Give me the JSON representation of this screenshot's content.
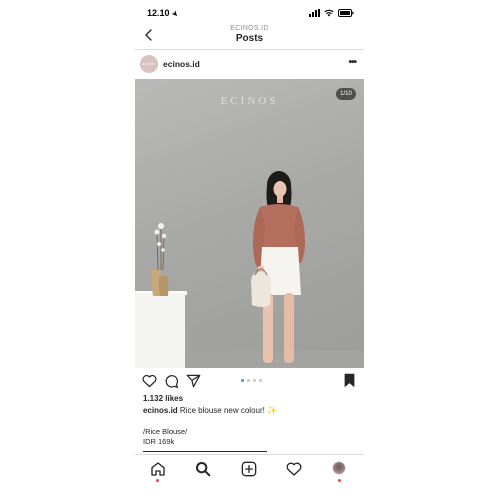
{
  "status_bar": {
    "time": "12.10"
  },
  "header": {
    "account": "ECINOS.ID",
    "title": "Posts"
  },
  "post": {
    "avatar_text": "ECINOS",
    "username": "ecinos.id",
    "image": {
      "brand": "ECINOS",
      "counter": "1/10"
    },
    "carousel": {
      "dot_count": 4,
      "active_index": 0
    },
    "likes": "1.132 likes",
    "caption": {
      "username": "ecinos.id",
      "text": "Rice blouse new colour! ✨",
      "line1": "/Rice Blouse/",
      "line2": "IDR 169k"
    }
  },
  "colors": {
    "accent_blue": "#3897f0",
    "notification_red": "#ed4956",
    "text": "#262626",
    "muted": "#8e8e8e"
  }
}
